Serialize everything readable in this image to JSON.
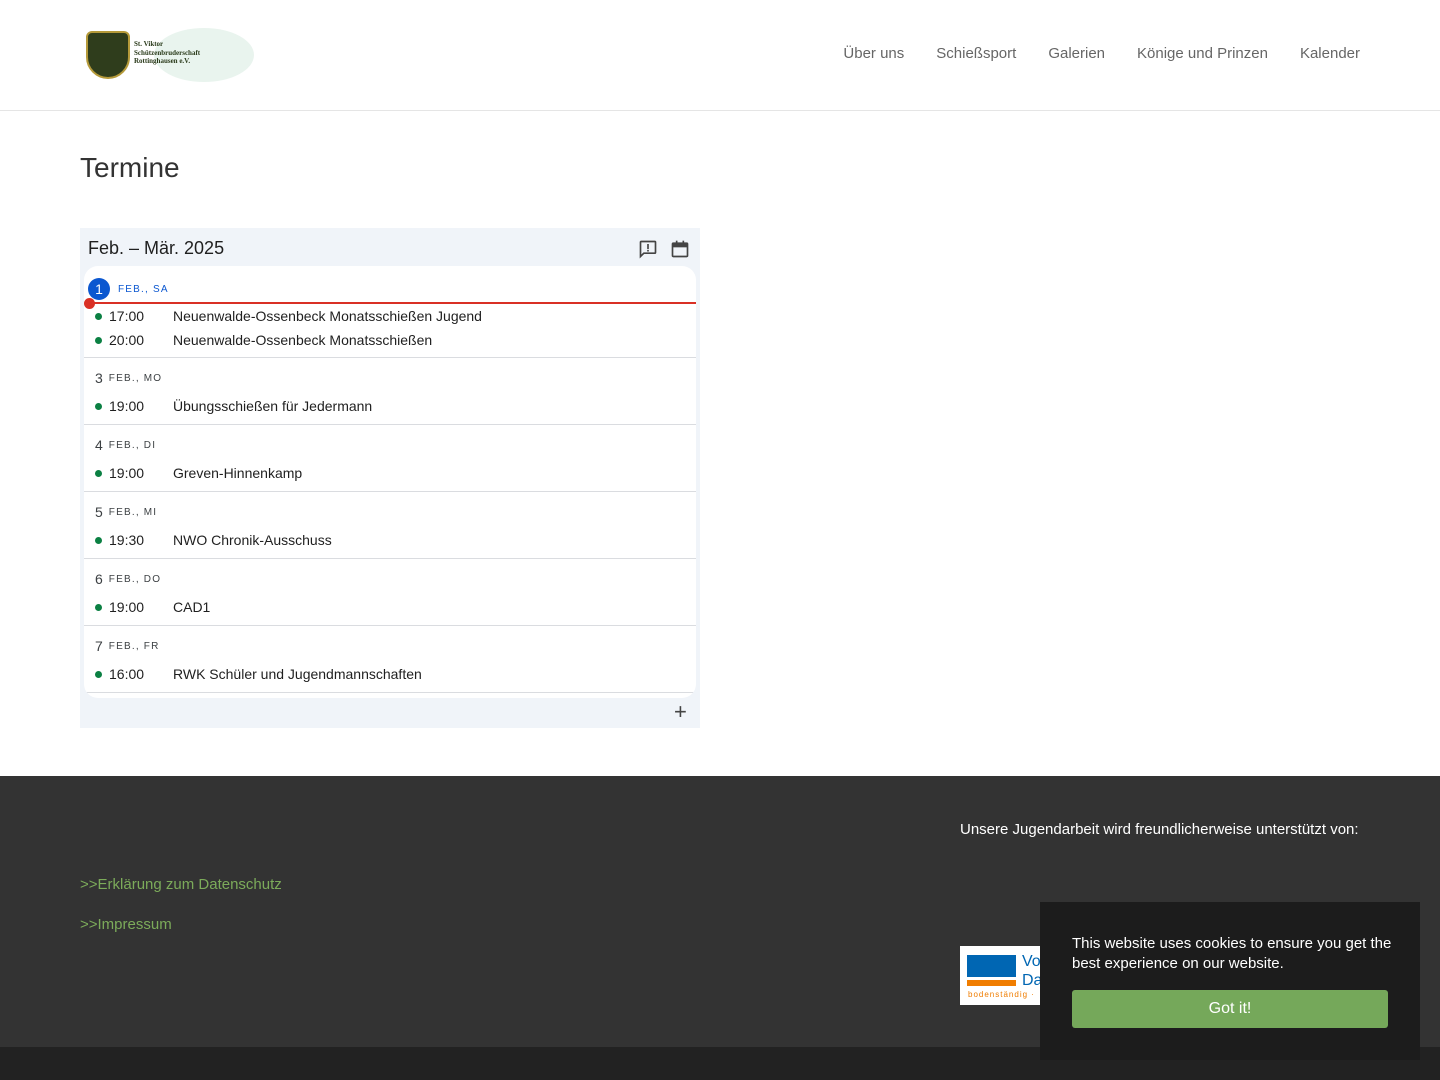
{
  "header": {
    "logo_text": "St. Viktor Schützenbruderschaft Rottinghausen e.V.",
    "nav": [
      "Über uns",
      "Schießsport",
      "Galerien",
      "Könige und Prinzen",
      "Kalender"
    ]
  },
  "page_title": "Termine",
  "calendar": {
    "range": "Feb. – Mär. 2025",
    "icons": [
      "feedback-icon",
      "calendar-icon",
      "plus-icon"
    ],
    "event_color": "#0b8043",
    "today_color": "#0b57d0",
    "now_line_color": "#d93025",
    "days": [
      {
        "num": "1",
        "weekday": "FEB., SA",
        "today": true,
        "events": [
          {
            "time": "17:00",
            "title": "Neuenwalde-Ossenbeck Monatsschießen Jugend"
          },
          {
            "time": "20:00",
            "title": "Neuenwalde-Ossenbeck Monatsschießen"
          }
        ]
      },
      {
        "num": "3",
        "weekday": "FEB., MO",
        "events": [
          {
            "time": "19:00",
            "title": "Übungsschießen für Jedermann"
          }
        ]
      },
      {
        "num": "4",
        "weekday": "FEB., DI",
        "events": [
          {
            "time": "19:00",
            "title": "Greven-Hinnenkamp"
          }
        ]
      },
      {
        "num": "5",
        "weekday": "FEB., MI",
        "events": [
          {
            "time": "19:30",
            "title": "NWO Chronik-Ausschuss"
          }
        ]
      },
      {
        "num": "6",
        "weekday": "FEB., DO",
        "events": [
          {
            "time": "19:00",
            "title": "CAD1"
          }
        ]
      },
      {
        "num": "7",
        "weekday": "FEB., FR",
        "events": [
          {
            "time": "16:00",
            "title": "RWK Schüler und Jugendmannschaften"
          }
        ]
      }
    ]
  },
  "footer": {
    "links": [
      ">>Erklärung zum Datenschutz",
      ">>Impressum"
    ],
    "support_text": "Unsere Jugendarbeit wird freundlicherweise unterstützt von:",
    "sponsor_logo": {
      "text": "Vo Da",
      "slogan": "bodenständig ·"
    }
  },
  "cookie": {
    "message": "This website uses cookies to ensure you get the best experience on our website.",
    "button": "Got it!"
  }
}
